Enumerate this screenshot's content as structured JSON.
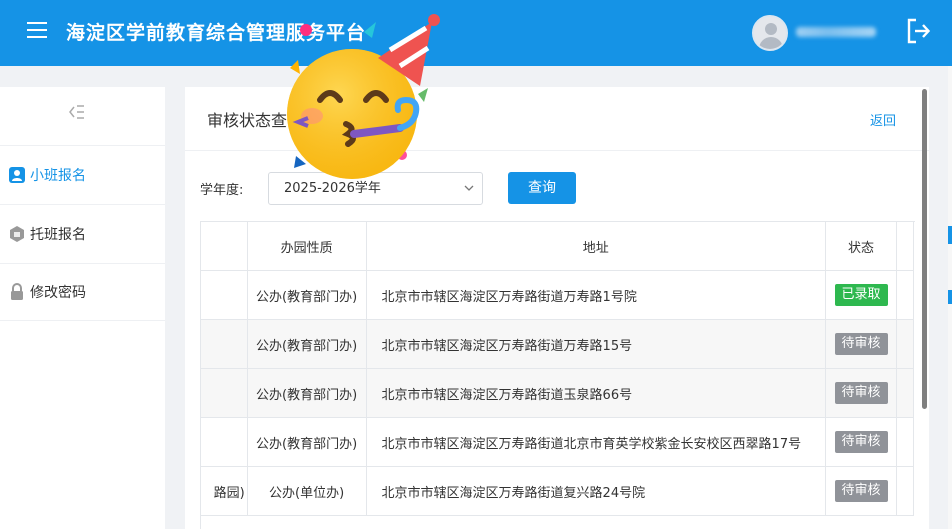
{
  "header": {
    "app_title": "海淀区学前教育综合管理服务平台",
    "icons": {
      "menu": "hamburger-menu-icon",
      "avatar": "user-avatar-icon",
      "logout": "logout-icon"
    }
  },
  "sidebar": {
    "items": [
      {
        "label": "小班报名",
        "icon": "user-badge-icon",
        "active": true
      },
      {
        "label": "托班报名",
        "icon": "hexagon-badge-icon",
        "active": false
      },
      {
        "label": "修改密码",
        "icon": "lock-icon",
        "active": false
      }
    ]
  },
  "main": {
    "title": "审核状态查",
    "back_label": "返回",
    "filter": {
      "year_label": "学年度:",
      "year_value": "2025-2026学年",
      "query_label": "查询"
    },
    "table": {
      "columns": [
        "",
        "办园性质",
        "地址",
        "状态"
      ],
      "rows": [
        {
          "c0": "",
          "c1": "公办(教育部门办)",
          "c2": "北京市市辖区海淀区万寿路街道万寿路1号院",
          "status": "已录取",
          "status_color": "#2eb84f"
        },
        {
          "c0": "",
          "c1": "公办(教育部门办)",
          "c2": "北京市市辖区海淀区万寿路街道万寿路15号",
          "status": "待审核",
          "status_color": "#909399"
        },
        {
          "c0": "",
          "c1": "公办(教育部门办)",
          "c2": "北京市市辖区海淀区万寿路街道玉泉路66号",
          "status": "待审核",
          "status_color": "#909399"
        },
        {
          "c0": "",
          "c1": "公办(教育部门办)",
          "c2": "北京市市辖区海淀区万寿路街道北京市育英学校紫金长安校区西翠路17号",
          "status": "待审核",
          "status_color": "#909399"
        },
        {
          "c0": "路园)",
          "c1": "公办(单位办)",
          "c2": "北京市市辖区海淀区万寿路街道复兴路24号院",
          "status": "待审核",
          "status_color": "#909399"
        }
      ]
    }
  },
  "overlay": {
    "icon": "party-face-emoji-icon"
  },
  "colors": {
    "accent": "#1593e6",
    "admitted": "#2eb84f",
    "pending": "#909399"
  }
}
